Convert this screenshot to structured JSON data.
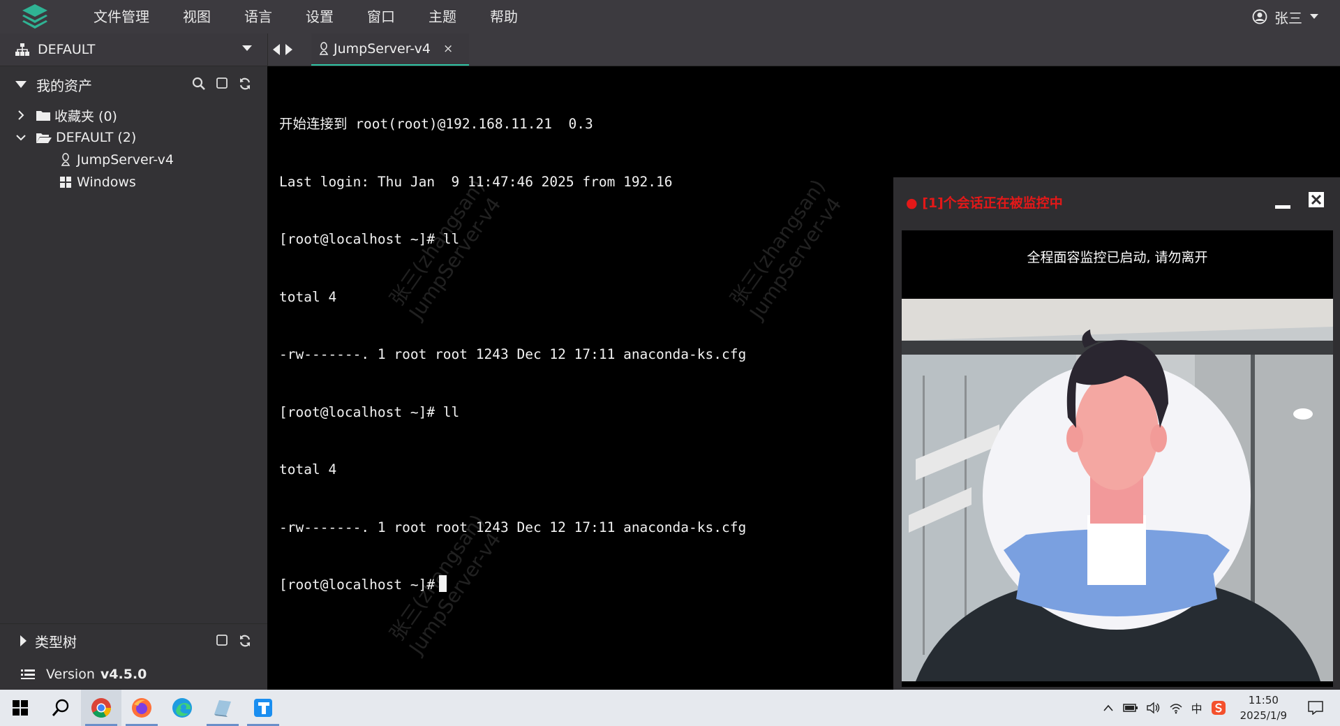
{
  "menubar": {
    "items": [
      "文件管理",
      "视图",
      "语言",
      "设置",
      "窗口",
      "主题",
      "帮助"
    ],
    "user": "张三"
  },
  "subbar": {
    "org": "DEFAULT",
    "tab_title": "JumpServer-v4",
    "tab_close": "×"
  },
  "sidebar": {
    "title": "我的资产",
    "favorites": "收藏夹 (0)",
    "default_group": "DEFAULT (2)",
    "assets": [
      "JumpServer-v4",
      "Windows"
    ],
    "type_tree": "类型树",
    "version_label": "Version",
    "version": "v4.5.0"
  },
  "terminal": {
    "lines": [
      "开始连接到 root(root)@192.168.11.21  0.3",
      "Last login: Thu Jan  9 11:47:46 2025 from 192.16",
      "[root@localhost ~]# ll",
      "total 4",
      "-rw-------. 1 root root 1243 Dec 12 17:11 anaconda-ks.cfg",
      "[root@localhost ~]# ll",
      "total 4",
      "-rw-------. 1 root root 1243 Dec 12 17:11 anaconda-ks.cfg",
      "[root@localhost ~]#"
    ],
    "watermark": "张三(zhangsan)\nJumpServer-v4"
  },
  "monitor": {
    "title": "● [1]个会话正在被监控中",
    "message": "全程面容监控已启动, 请勿离开"
  },
  "taskbar": {
    "time": "11:50",
    "date": "2025/1/9",
    "ime": "中"
  },
  "colors": {
    "accent": "#30c4a4",
    "alert": "#e41818",
    "sidebar_bg": "#333235",
    "menubar_bg": "#3c3a3f"
  }
}
